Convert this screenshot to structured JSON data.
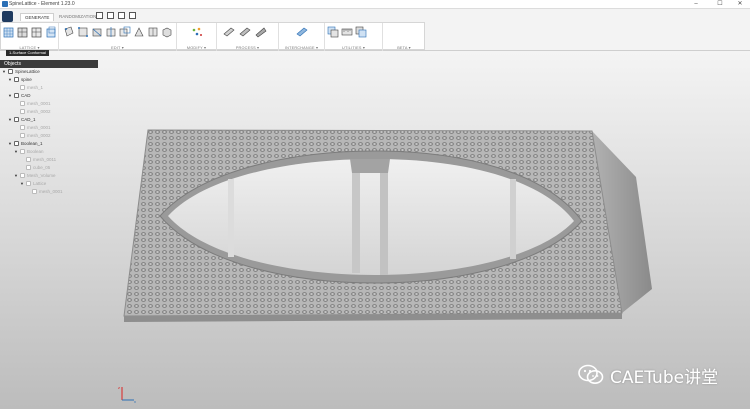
{
  "window": {
    "title": "SpineLattice - Element 1.23.0",
    "minimize": "–",
    "maximize": "☐",
    "close": "✕"
  },
  "ribbon": {
    "tabs": [
      "GENERATE",
      "RANDOMIZATION"
    ],
    "groups": {
      "lattice": "LATTICE ▾",
      "edit": "EDIT ▾",
      "modify": "MODIFY ▾",
      "process": "PROCESS ▾",
      "interchange": "INTERCHANGE ▾",
      "utilities": "UTILITIES ▾",
      "beta": "BETA ▾"
    },
    "tooltip": "1-Surface Conformal"
  },
  "objects_panel": {
    "title": "Objects",
    "rows": [
      {
        "label": "SpineLattice",
        "indent": 0,
        "dim": false,
        "expander": "▼"
      },
      {
        "label": "spine",
        "indent": 1,
        "dim": false,
        "expander": "▼"
      },
      {
        "label": "mesh_1",
        "indent": 2,
        "dim": true,
        "expander": ""
      },
      {
        "label": "CAD",
        "indent": 1,
        "dim": false,
        "expander": "▼"
      },
      {
        "label": "mesh_0001",
        "indent": 2,
        "dim": true,
        "expander": ""
      },
      {
        "label": "mesh_0002",
        "indent": 2,
        "dim": true,
        "expander": ""
      },
      {
        "label": "CAD_1",
        "indent": 1,
        "dim": false,
        "expander": "▼"
      },
      {
        "label": "mesh_0001",
        "indent": 2,
        "dim": true,
        "expander": ""
      },
      {
        "label": "mesh_0002",
        "indent": 2,
        "dim": true,
        "expander": ""
      },
      {
        "label": "Boolean_1",
        "indent": 1,
        "dim": false,
        "expander": "▼"
      },
      {
        "label": "Boolean",
        "indent": 2,
        "dim": true,
        "expander": "▼"
      },
      {
        "label": "mesh_0011",
        "indent": 3,
        "dim": true,
        "expander": ""
      },
      {
        "label": "cube_05",
        "indent": 3,
        "dim": true,
        "expander": ""
      },
      {
        "label": "Mesh_Volume",
        "indent": 2,
        "dim": true,
        "expander": "▼"
      },
      {
        "label": "Lattice",
        "indent": 3,
        "dim": true,
        "expander": "▼"
      },
      {
        "label": "mesh_0001",
        "indent": 4,
        "dim": true,
        "expander": ""
      }
    ]
  },
  "viewport": {
    "axis_label_z": "z",
    "axis_label_x": "x"
  },
  "watermark": {
    "text": "CAETube讲堂"
  },
  "colors": {
    "accent": "#2b6fb5",
    "panel_header": "#3a3a3a",
    "viewport_top": "#f2f2f2",
    "viewport_bottom": "#bdbdbd",
    "part": "#a9a9a9"
  }
}
